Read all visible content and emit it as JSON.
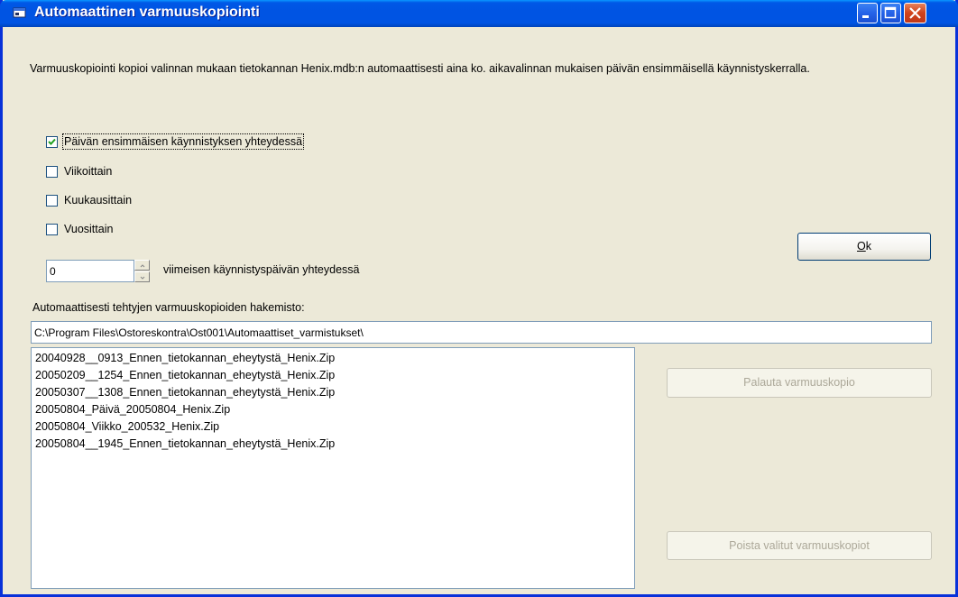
{
  "window": {
    "title": "Automaattinen varmuuskopiointi"
  },
  "description": "Varmuuskopiointi kopioi valinnan mukaan tietokannan Henix.mdb:n automaattisesti aina ko. aikavalinnan mukaisen päivän ensimmäisellä käynnistyskerralla.",
  "options": [
    {
      "label": "Päivän ensimmäisen käynnistyksen yhteydessä",
      "checked": true
    },
    {
      "label": "Viikoittain",
      "checked": false
    },
    {
      "label": "Kuukausittain",
      "checked": false
    },
    {
      "label": "Vuosittain",
      "checked": false
    }
  ],
  "days": {
    "value": "0",
    "label": "viimeisen käynnistyspäivän yhteydessä"
  },
  "directory": {
    "label": "Automaattisesti tehtyjen varmuuskopioiden hakemisto:",
    "path": "C:\\Program Files\\Ostoreskontra\\Ost001\\Automaattiset_varmistukset\\"
  },
  "files": [
    "20040928__0913_Ennen_tietokannan_eheytystä_Henix.Zip",
    "20050209__1254_Ennen_tietokannan_eheytystä_Henix.Zip",
    "20050307__1308_Ennen_tietokannan_eheytystä_Henix.Zip",
    "20050804_Päivä_20050804_Henix.Zip",
    "20050804_Viikko_200532_Henix.Zip",
    "20050804__1945_Ennen_tietokannan_eheytystä_Henix.Zip"
  ],
  "buttons": {
    "ok_key": "O",
    "ok_rest": "k",
    "restore": "Palauta varmuuskopio",
    "delete": "Poista valitut varmuuskopiot"
  }
}
